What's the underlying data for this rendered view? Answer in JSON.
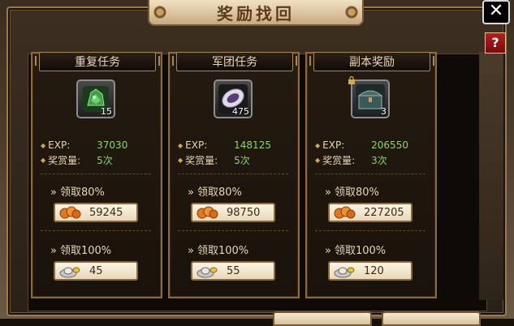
{
  "header": {
    "title": "奖励找回"
  },
  "cards": [
    {
      "title": "重复任务",
      "icon": "jade-stone-icon",
      "count": "15",
      "locked": false,
      "exp_label": "EXP:",
      "exp_value": "37030",
      "times_label": "奖赏量:",
      "times_value": "5次",
      "claim80_label": "领取80%",
      "claim80_value": "59245",
      "claim100_label": "领取100%",
      "claim100_value": "45"
    },
    {
      "title": "军团任务",
      "icon": "medallion-icon",
      "count": "475",
      "locked": false,
      "exp_label": "EXP:",
      "exp_value": "148125",
      "times_label": "奖赏量:",
      "times_value": "5次",
      "claim80_label": "领取80%",
      "claim80_value": "98750",
      "claim100_label": "领取100%",
      "claim100_value": "55"
    },
    {
      "title": "副本奖励",
      "icon": "treasure-chest-icon",
      "count": "3",
      "locked": true,
      "exp_label": "EXP:",
      "exp_value": "206550",
      "times_label": "奖赏量:",
      "times_value": "3次",
      "claim80_label": "领取80%",
      "claim80_value": "227205",
      "claim100_label": "领取100%",
      "claim100_value": "120"
    }
  ],
  "colors": {
    "exp_value": "#8fd36a",
    "frame_gold": "#8a6a3e",
    "help_red": "#b0201c"
  }
}
